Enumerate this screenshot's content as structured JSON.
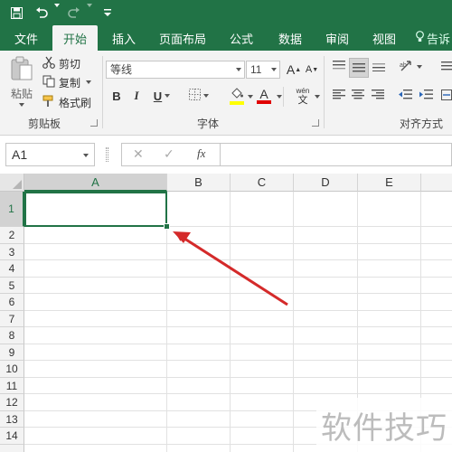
{
  "quick_access": {
    "save_icon": "save-icon",
    "undo_icon": "undo-icon",
    "redo_icon": "redo-icon",
    "customize_icon": "customize-icon"
  },
  "tabs": [
    {
      "label": "文件"
    },
    {
      "label": "开始"
    },
    {
      "label": "插入"
    },
    {
      "label": "页面布局"
    },
    {
      "label": "公式"
    },
    {
      "label": "数据"
    },
    {
      "label": "审阅"
    },
    {
      "label": "视图"
    },
    {
      "label": "告诉"
    }
  ],
  "ribbon": {
    "clipboard": {
      "paste_label": "粘贴",
      "cut_label": "剪切",
      "copy_label": "复制",
      "format_painter_label": "格式刷",
      "group_label": "剪贴板"
    },
    "font": {
      "font_name": "等线",
      "font_size": "11",
      "grow_label": "A",
      "shrink_label": "A",
      "bold_label": "B",
      "italic_label": "I",
      "underline_label": "U",
      "font_color_label": "A",
      "wen_label": "wén",
      "wen_char": "文",
      "group_label": "字体"
    },
    "alignment": {
      "group_label": "对齐方式"
    },
    "colors": {
      "accent": "#217346",
      "fill_yellow": "#ffff00",
      "font_red": "#e00000"
    }
  },
  "formula_bar": {
    "name_box": "A1",
    "cancel": "✕",
    "enter": "✓",
    "fx": "fx",
    "formula": ""
  },
  "grid": {
    "columns": [
      "A",
      "B",
      "C",
      "D",
      "E"
    ],
    "rows": [
      "1",
      "2",
      "3",
      "4",
      "5",
      "6",
      "7",
      "8",
      "9",
      "10",
      "11",
      "12",
      "13",
      "14"
    ],
    "selected_cell": "A1"
  },
  "watermark": "软件技巧"
}
